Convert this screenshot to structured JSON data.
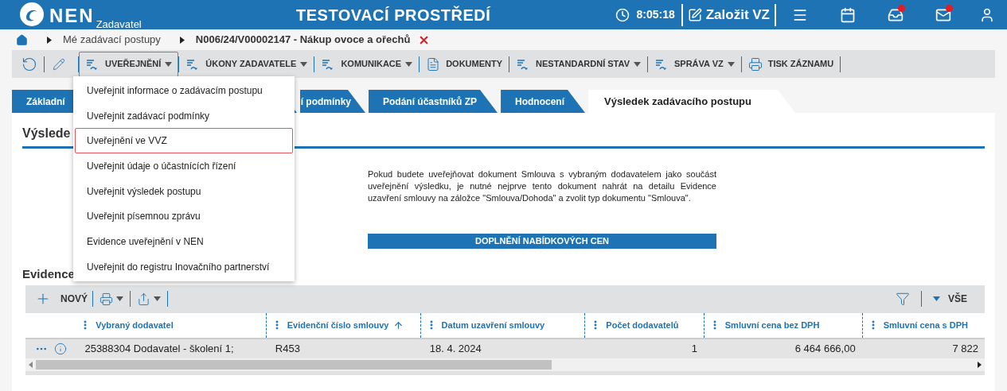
{
  "header": {
    "logo": "NEN",
    "subtitle": "Zadavatel",
    "environment": "TESTOVACÍ PROSTŘEDÍ",
    "time": "8:05:18",
    "create_button": "Založit VZ",
    "icons": [
      {
        "kind": "menu",
        "badge": false
      },
      {
        "kind": "calendar",
        "badge": false
      },
      {
        "kind": "inbox",
        "badge": true
      },
      {
        "kind": "mail",
        "badge": true
      },
      {
        "kind": "user",
        "badge": false
      }
    ]
  },
  "breadcrumb": [
    "Mé zadávací postupy",
    "N006/24/V00002147 - Nákup ovoce a ořechů"
  ],
  "toolbar": [
    {
      "kind": "refresh"
    },
    {
      "kind": "edit"
    },
    {
      "kind": "action",
      "label": "UVEŘEJNĚNÍ",
      "dropdown": true,
      "selected": true
    },
    {
      "kind": "action",
      "label": "ÚKONY ZADAVATELE",
      "dropdown": true,
      "selected": false
    },
    {
      "kind": "action",
      "label": "KOMUNIKACE",
      "dropdown": true,
      "selected": false
    },
    {
      "kind": "documents",
      "label": "DOKUMENTY",
      "dropdown": false,
      "selected": false
    },
    {
      "kind": "action",
      "label": "NESTANDARDNÍ STAV",
      "dropdown": true,
      "selected": false
    },
    {
      "kind": "action",
      "label": "SPRÁVA VZ",
      "dropdown": true,
      "selected": false
    },
    {
      "kind": "print",
      "label": "TISK ZÁZNAMU",
      "dropdown": false,
      "selected": false
    }
  ],
  "dropdown_menu": [
    {
      "label": "Uveřejnit informace o zadávacím postupu",
      "selected": false
    },
    {
      "label": "Uveřejnit zadávací podmínky",
      "selected": false
    },
    {
      "label": "Uveřejnění ve VVZ",
      "selected": true
    },
    {
      "label": "Uveřejnit údaje o účastnících řízení",
      "selected": false
    },
    {
      "label": "Uveřejnit výsledek postupu",
      "selected": false
    },
    {
      "label": "Uveřejnit písemnou zprávu",
      "selected": false
    },
    {
      "label": "Evidence uveřejnění v NEN",
      "selected": false
    },
    {
      "label": "Uveřejnit do registru Inovačního partnerství",
      "selected": false
    }
  ],
  "tabs": [
    {
      "label": "Základní",
      "selected": false
    },
    {
      "label": "í podmínky",
      "selected": false
    },
    {
      "label": "Podání účastníků ZP",
      "selected": false
    },
    {
      "label": "Hodnocení",
      "selected": false
    },
    {
      "label": "Výsledek zadávacího postupu",
      "selected": true
    }
  ],
  "section_title": "Výslede",
  "notice": "Pokud budete uveřejňovat dokument Smlouva s vybraným dodavatelem jako součást uveřejnění výsledku, je nutné nejprve tento dokument nahrát na detailu Evidence uzavření smlouvy na záložce \"Smlouva/Dohoda\" a zvolit typ dokumentu \"Smlouva\".",
  "action_button": "DOPLNĚNÍ NABÍDKOVÝCH CEN",
  "subsection_title": "Evidence",
  "grid": {
    "new_button": "NOVÝ",
    "view_button": "VŠE",
    "columns": [
      {
        "label": "Vybraný dodavatel",
        "sorted": false
      },
      {
        "label": "Evidenční číslo smlouvy",
        "sorted": true
      },
      {
        "label": "Datum uzavření smlouvy",
        "sorted": false
      },
      {
        "label": "Počet dodavatelů",
        "sorted": false
      },
      {
        "label": "Smluvní cena bez DPH",
        "sorted": false
      },
      {
        "label": "Smluvní cena s DPH",
        "sorted": false
      }
    ],
    "rows": [
      [
        "25388304 Dodavatel - školení 1;",
        "R453",
        "18. 4. 2024",
        "1",
        "6 464 666,00",
        "7 822"
      ]
    ]
  }
}
